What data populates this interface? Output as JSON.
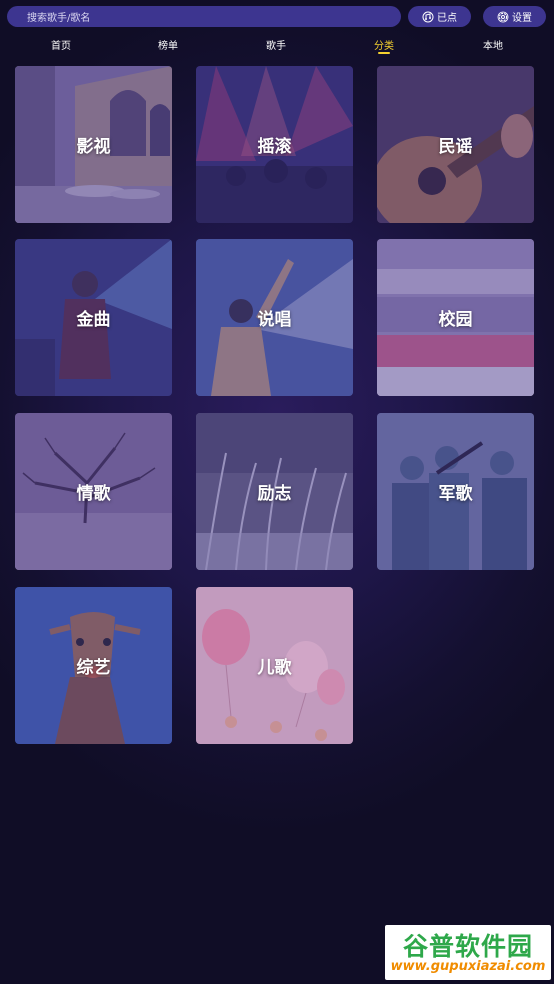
{
  "search": {
    "placeholder": "搜索歌手/歌名"
  },
  "queue_button": {
    "label": "已点"
  },
  "settings_button": {
    "label": "设置"
  },
  "tabs": [
    {
      "label": "首页",
      "active": false
    },
    {
      "label": "榜单",
      "active": false
    },
    {
      "label": "歌手",
      "active": false
    },
    {
      "label": "分类",
      "active": true
    },
    {
      "label": "本地",
      "active": false
    }
  ],
  "categories": [
    {
      "label": "影视"
    },
    {
      "label": "摇滚"
    },
    {
      "label": "民谣"
    },
    {
      "label": "金曲"
    },
    {
      "label": "说唱"
    },
    {
      "label": "校园"
    },
    {
      "label": "情歌"
    },
    {
      "label": "励志"
    },
    {
      "label": "军歌"
    },
    {
      "label": "综艺"
    },
    {
      "label": "儿歌"
    }
  ],
  "watermark": {
    "title": "谷普软件园",
    "url": "www.gupuxiazai.com"
  },
  "colors": {
    "accent": "#f5d130",
    "pill_bg": "#3d3590",
    "tile_overlay": "#46378c"
  }
}
